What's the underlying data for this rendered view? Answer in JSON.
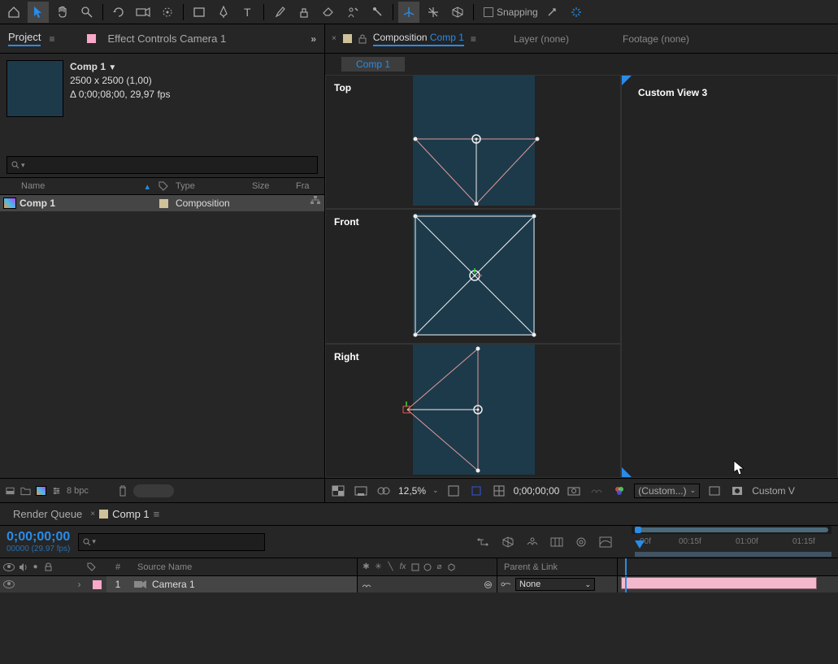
{
  "toolbar": {
    "snapping_label": "Snapping"
  },
  "project": {
    "tab_project": "Project",
    "tab_effect_controls": "Effect Controls Camera 1",
    "comp_title": "Comp 1",
    "comp_dims": "2500 x 2500 (1,00)",
    "comp_duration": "Δ 0;00;08;00, 29,97 fps",
    "col_name": "Name",
    "col_type": "Type",
    "col_size": "Size",
    "col_fr": "Fra",
    "row_name": "Comp 1",
    "row_type": "Composition",
    "bpc": "8 bpc"
  },
  "comp": {
    "tab_comp_label": "Composition",
    "tab_comp_name": "Comp 1",
    "tab_layer": "Layer (none)",
    "tab_footage": "Footage (none)",
    "subtab": "Comp 1",
    "view_top": "Top",
    "view_front": "Front",
    "view_right": "Right",
    "view_custom": "Custom View 3",
    "zoom": "12,5%",
    "time": "0;00;00;00",
    "view_dropdown": "(Custom...)",
    "view_dropdown2": "Custom V"
  },
  "timeline": {
    "tab_render": "Render Queue",
    "tab_comp": "Comp 1",
    "timecode": "0;00;00;00",
    "timecode_sub": "00000 (29.97 fps)",
    "col_num": "#",
    "col_source": "Source Name",
    "col_parent": "Parent & Link",
    "layer_num": "1",
    "layer_name": "Camera 1",
    "parent_value": "None",
    "ruler": [
      "00f",
      "00:15f",
      "01:00f",
      "01:15f"
    ]
  }
}
